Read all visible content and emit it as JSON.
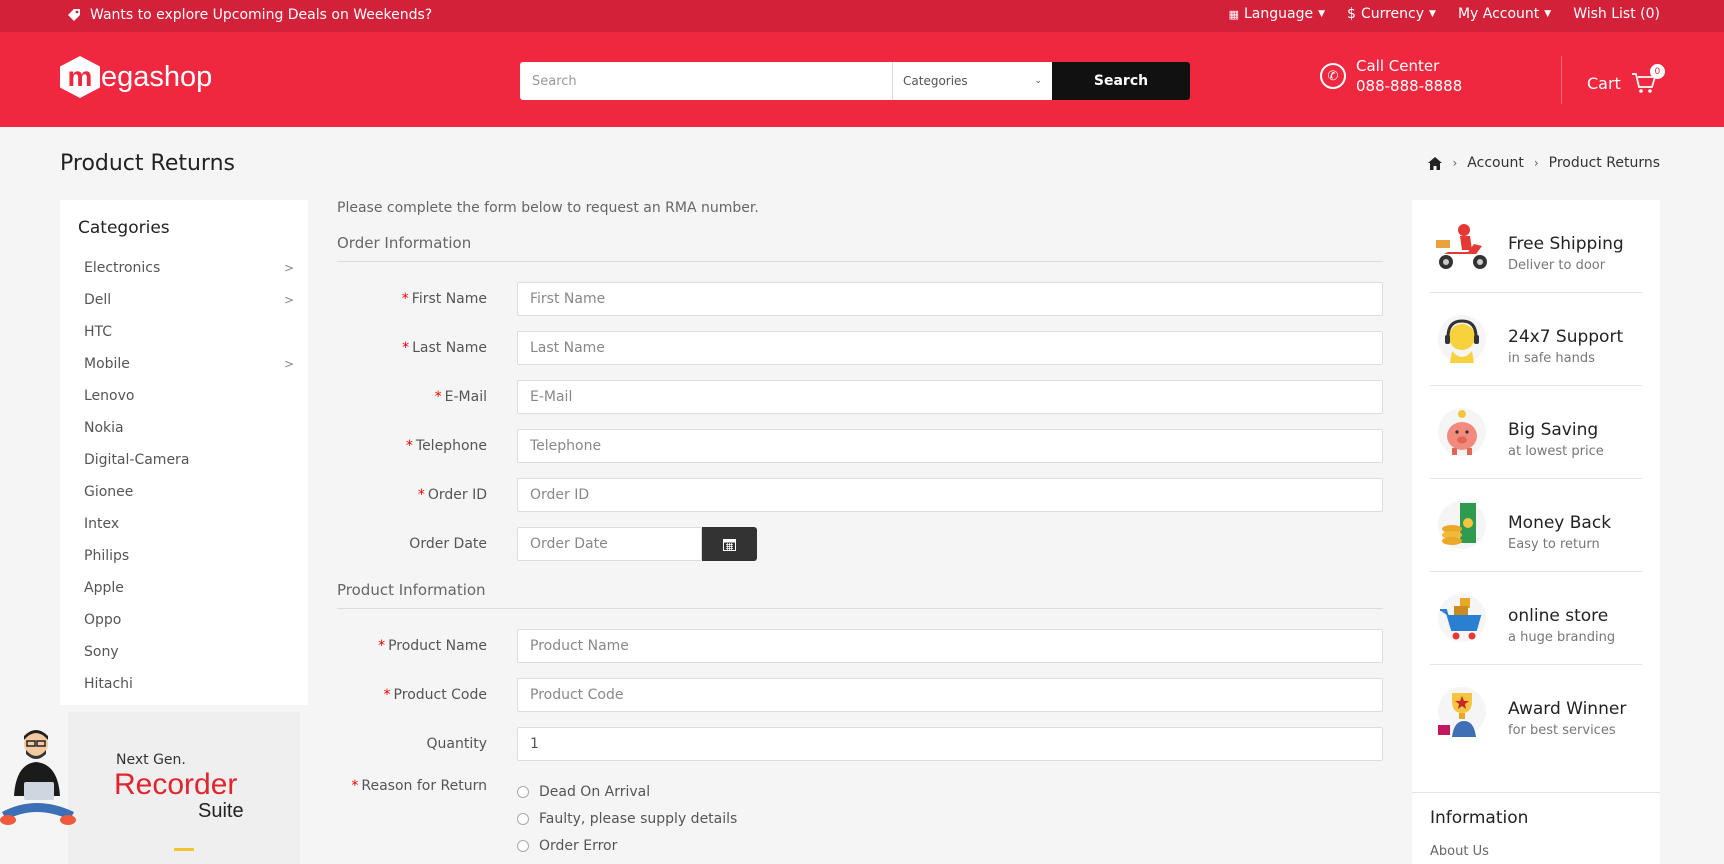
{
  "topbar": {
    "promo": "Wants to explore Upcoming Deals on Weekends?",
    "language": "Language",
    "currency": "Currency",
    "currency_symbol": "$",
    "my_account": "My Account",
    "wishlist": "Wish List (0)"
  },
  "header": {
    "logo_initial": "m",
    "logo_rest": "egashop",
    "search_placeholder": "Search",
    "categories_label": "Categories",
    "search_button": "Search",
    "call_title": "Call Center",
    "call_number": "088-888-8888",
    "cart_label": "Cart",
    "cart_count": "0"
  },
  "page": {
    "title": "Product Returns",
    "breadcrumb": [
      "Account",
      "Product Returns"
    ]
  },
  "sidebar": {
    "title": "Categories",
    "items": [
      {
        "label": "Electronics",
        "arrow": ">"
      },
      {
        "label": "Dell",
        "arrow": ">"
      },
      {
        "label": "HTC",
        "arrow": ""
      },
      {
        "label": "Mobile",
        "arrow": ">"
      },
      {
        "label": "Lenovo",
        "arrow": ""
      },
      {
        "label": "Nokia",
        "arrow": ""
      },
      {
        "label": "Digital-Camera",
        "arrow": ""
      },
      {
        "label": "Gionee",
        "arrow": ""
      },
      {
        "label": "Intex",
        "arrow": ""
      },
      {
        "label": "Philips",
        "arrow": ""
      },
      {
        "label": "Apple",
        "arrow": ""
      },
      {
        "label": "Oppo",
        "arrow": ""
      },
      {
        "label": "Sony",
        "arrow": ""
      },
      {
        "label": "Hitachi",
        "arrow": ""
      }
    ],
    "banner": {
      "line1": "Next Gen.",
      "line2": "Recorder",
      "line3": "Suite"
    }
  },
  "form": {
    "intro": "Please complete the form below to request an RMA number.",
    "order_legend": "Order Information",
    "product_legend": "Product Information",
    "first_name": {
      "label": "First Name",
      "placeholder": "First Name"
    },
    "last_name": {
      "label": "Last Name",
      "placeholder": "Last Name"
    },
    "email": {
      "label": "E-Mail",
      "placeholder": "E-Mail"
    },
    "telephone": {
      "label": "Telephone",
      "placeholder": "Telephone"
    },
    "order_id": {
      "label": "Order ID",
      "placeholder": "Order ID"
    },
    "order_date": {
      "label": "Order Date",
      "placeholder": "Order Date"
    },
    "product_name": {
      "label": "Product Name",
      "placeholder": "Product Name"
    },
    "product_code": {
      "label": "Product Code",
      "placeholder": "Product Code"
    },
    "quantity": {
      "label": "Quantity",
      "value": "1"
    },
    "reason": {
      "label": "Reason for Return",
      "options": [
        "Dead On Arrival",
        "Faulty, please supply details",
        "Order Error"
      ]
    }
  },
  "services": [
    {
      "title": "Free Shipping",
      "sub": "Deliver to door"
    },
    {
      "title": "24x7 Support",
      "sub": "in safe hands"
    },
    {
      "title": "Big Saving",
      "sub": "at lowest price"
    },
    {
      "title": "Money Back",
      "sub": "Easy to return"
    },
    {
      "title": "online store",
      "sub": "a huge branding"
    },
    {
      "title": "Award Winner",
      "sub": "for best services"
    }
  ],
  "information": {
    "title": "Information",
    "first_link": "About Us"
  },
  "colors": {
    "brand": "#f0283f",
    "topbar": "#d4213a",
    "accent_red": "#e1252d"
  }
}
